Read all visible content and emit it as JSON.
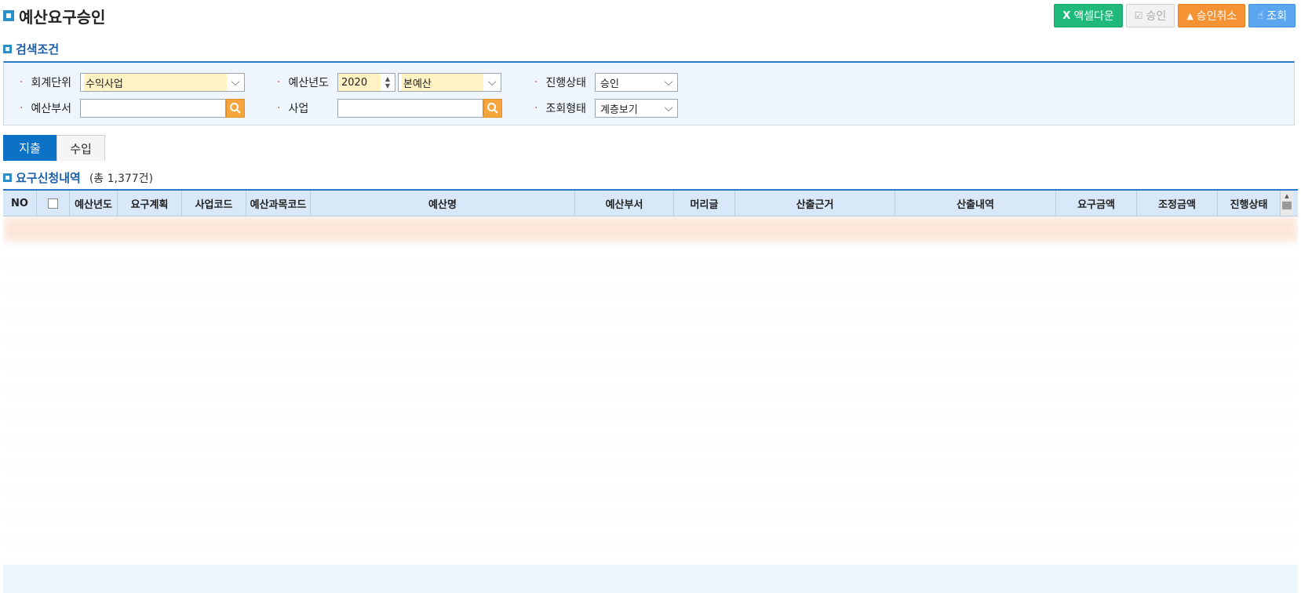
{
  "page": {
    "title": "예산요구승인"
  },
  "toolbar": {
    "excel_label": "액셀다운",
    "approve_label": "승인",
    "cancel_label": "승인취소",
    "search_label": "조회"
  },
  "search": {
    "section_title": "검색조건",
    "fields": {
      "accounting_unit": {
        "label": "회계단위",
        "value": "수익사업"
      },
      "budget_year": {
        "label": "예산년도",
        "value": "2020",
        "type_value": "본예산"
      },
      "progress_status": {
        "label": "진행상태",
        "value": "승인"
      },
      "budget_dept": {
        "label": "예산부서",
        "value": ""
      },
      "business": {
        "label": "사업",
        "value": ""
      },
      "view_type": {
        "label": "조회형태",
        "value": "계층보기"
      }
    }
  },
  "tabs": [
    {
      "label": "지출",
      "active": true
    },
    {
      "label": "수입",
      "active": false
    }
  ],
  "list": {
    "section_title": "요구신청내역",
    "count_text": "(총 1,377건)"
  },
  "grid": {
    "columns": [
      {
        "key": "no",
        "label": "NO"
      },
      {
        "key": "check",
        "label": ""
      },
      {
        "key": "year",
        "label": "예산년도"
      },
      {
        "key": "plan",
        "label": "요구계획"
      },
      {
        "key": "biz_code",
        "label": "사업코드"
      },
      {
        "key": "subject_code",
        "label": "예산과목코드"
      },
      {
        "key": "budget_name",
        "label": "예산명"
      },
      {
        "key": "dept",
        "label": "예산부서"
      },
      {
        "key": "prefix",
        "label": "머리글"
      },
      {
        "key": "basis",
        "label": "산출근거"
      },
      {
        "key": "detail",
        "label": "산출내역"
      },
      {
        "key": "req_amount",
        "label": "요구금액"
      },
      {
        "key": "adj_amount",
        "label": "조정금액"
      },
      {
        "key": "status",
        "label": "진행상태"
      }
    ]
  }
}
